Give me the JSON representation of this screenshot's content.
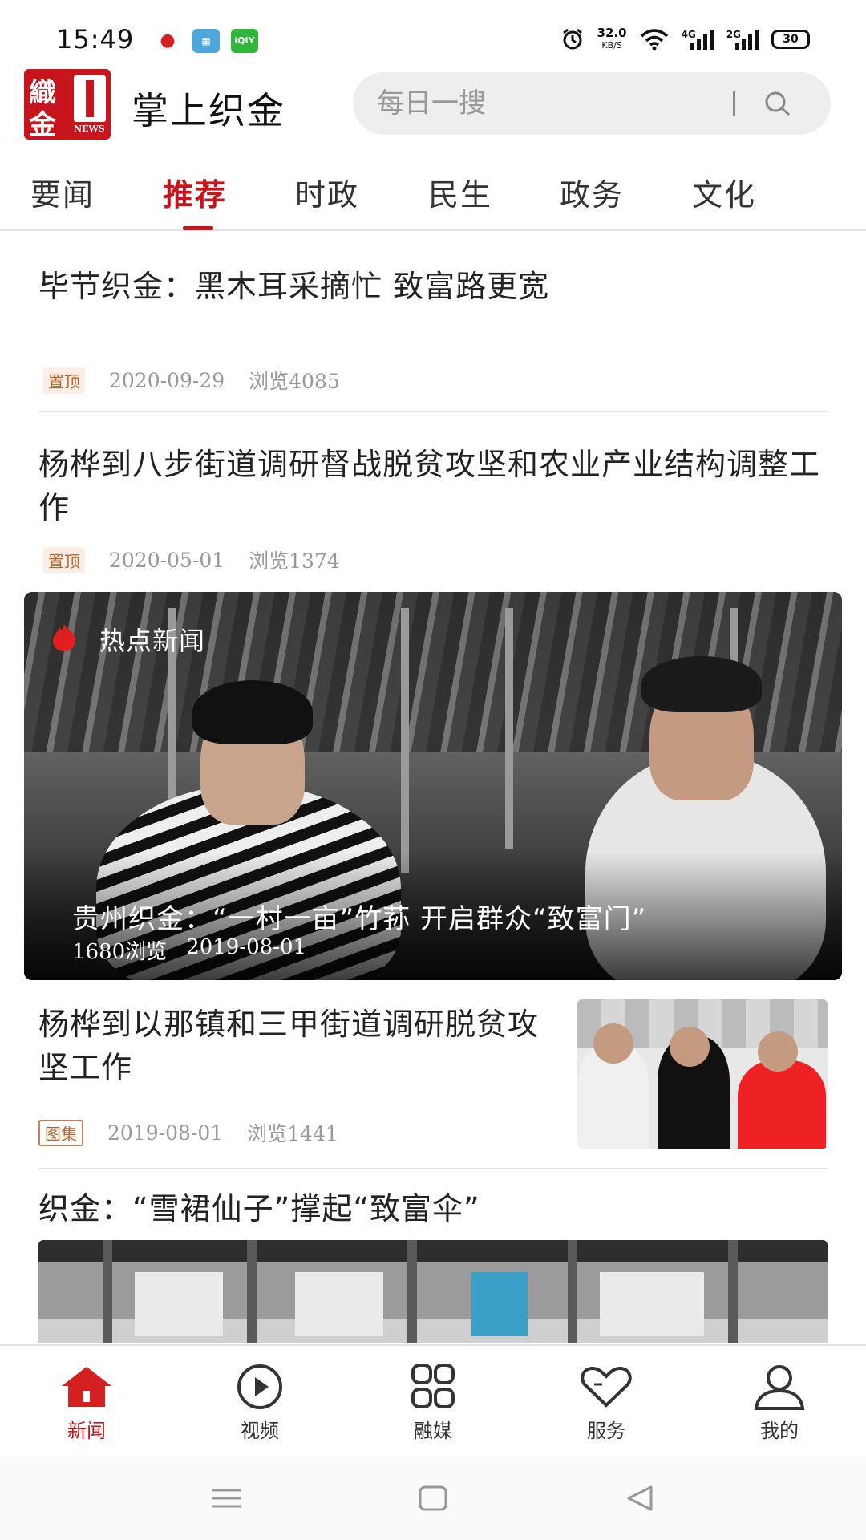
{
  "status_bar": {
    "time": "15:49",
    "net_speed": "32.0",
    "net_unit": "KB/S",
    "signal1": "4G",
    "signal2": "2G",
    "battery": "30",
    "app_icons": [
      "map-pin-app-icon",
      "gift-app-icon",
      "iqiyi-app-icon"
    ]
  },
  "header": {
    "logo_text": [
      "織",
      "金"
    ],
    "logo_sub": "NEWS",
    "title": "掌上织金",
    "search_placeholder": "每日一搜"
  },
  "tabs": [
    {
      "label": "要闻",
      "active": false
    },
    {
      "label": "推荐",
      "active": true
    },
    {
      "label": "时政",
      "active": false
    },
    {
      "label": "民生",
      "active": false
    },
    {
      "label": "政务",
      "active": false
    },
    {
      "label": "文化",
      "active": false
    }
  ],
  "articles": [
    {
      "title": "毕节织金：黑木耳采摘忙  致富路更宽",
      "badge": "置顶",
      "date": "2020-09-29",
      "views": "浏览4085"
    },
    {
      "title": "杨桦到八步街道调研督战脱贫攻坚和农业产业结构调整工作",
      "badge": "置顶",
      "date": "2020-05-01",
      "views": "浏览1374"
    }
  ],
  "hero": {
    "label": "热点新闻",
    "title": "贵州织金：“一村一亩”竹荪 开启群众“致富门”",
    "views": "1680浏览",
    "date": "2019-08-01"
  },
  "thumb_article": {
    "title": "杨桦到以那镇和三甲街道调研脱贫攻坚工作",
    "badge": "图集",
    "date": "2019-08-01",
    "views": "浏览1441"
  },
  "wide_article": {
    "title": "织金：“雪裙仙子”撑起“致富伞”"
  },
  "bottom_nav": [
    {
      "label": "新闻",
      "icon": "home-icon",
      "active": true
    },
    {
      "label": "视频",
      "icon": "play-circle-icon",
      "active": false
    },
    {
      "label": "融媒",
      "icon": "grid-icon",
      "active": false
    },
    {
      "label": "服务",
      "icon": "heart-icon",
      "active": false
    },
    {
      "label": "我的",
      "icon": "user-icon",
      "active": false
    }
  ],
  "colors": {
    "accent": "#c8141c",
    "badge_text": "#b5652e"
  }
}
